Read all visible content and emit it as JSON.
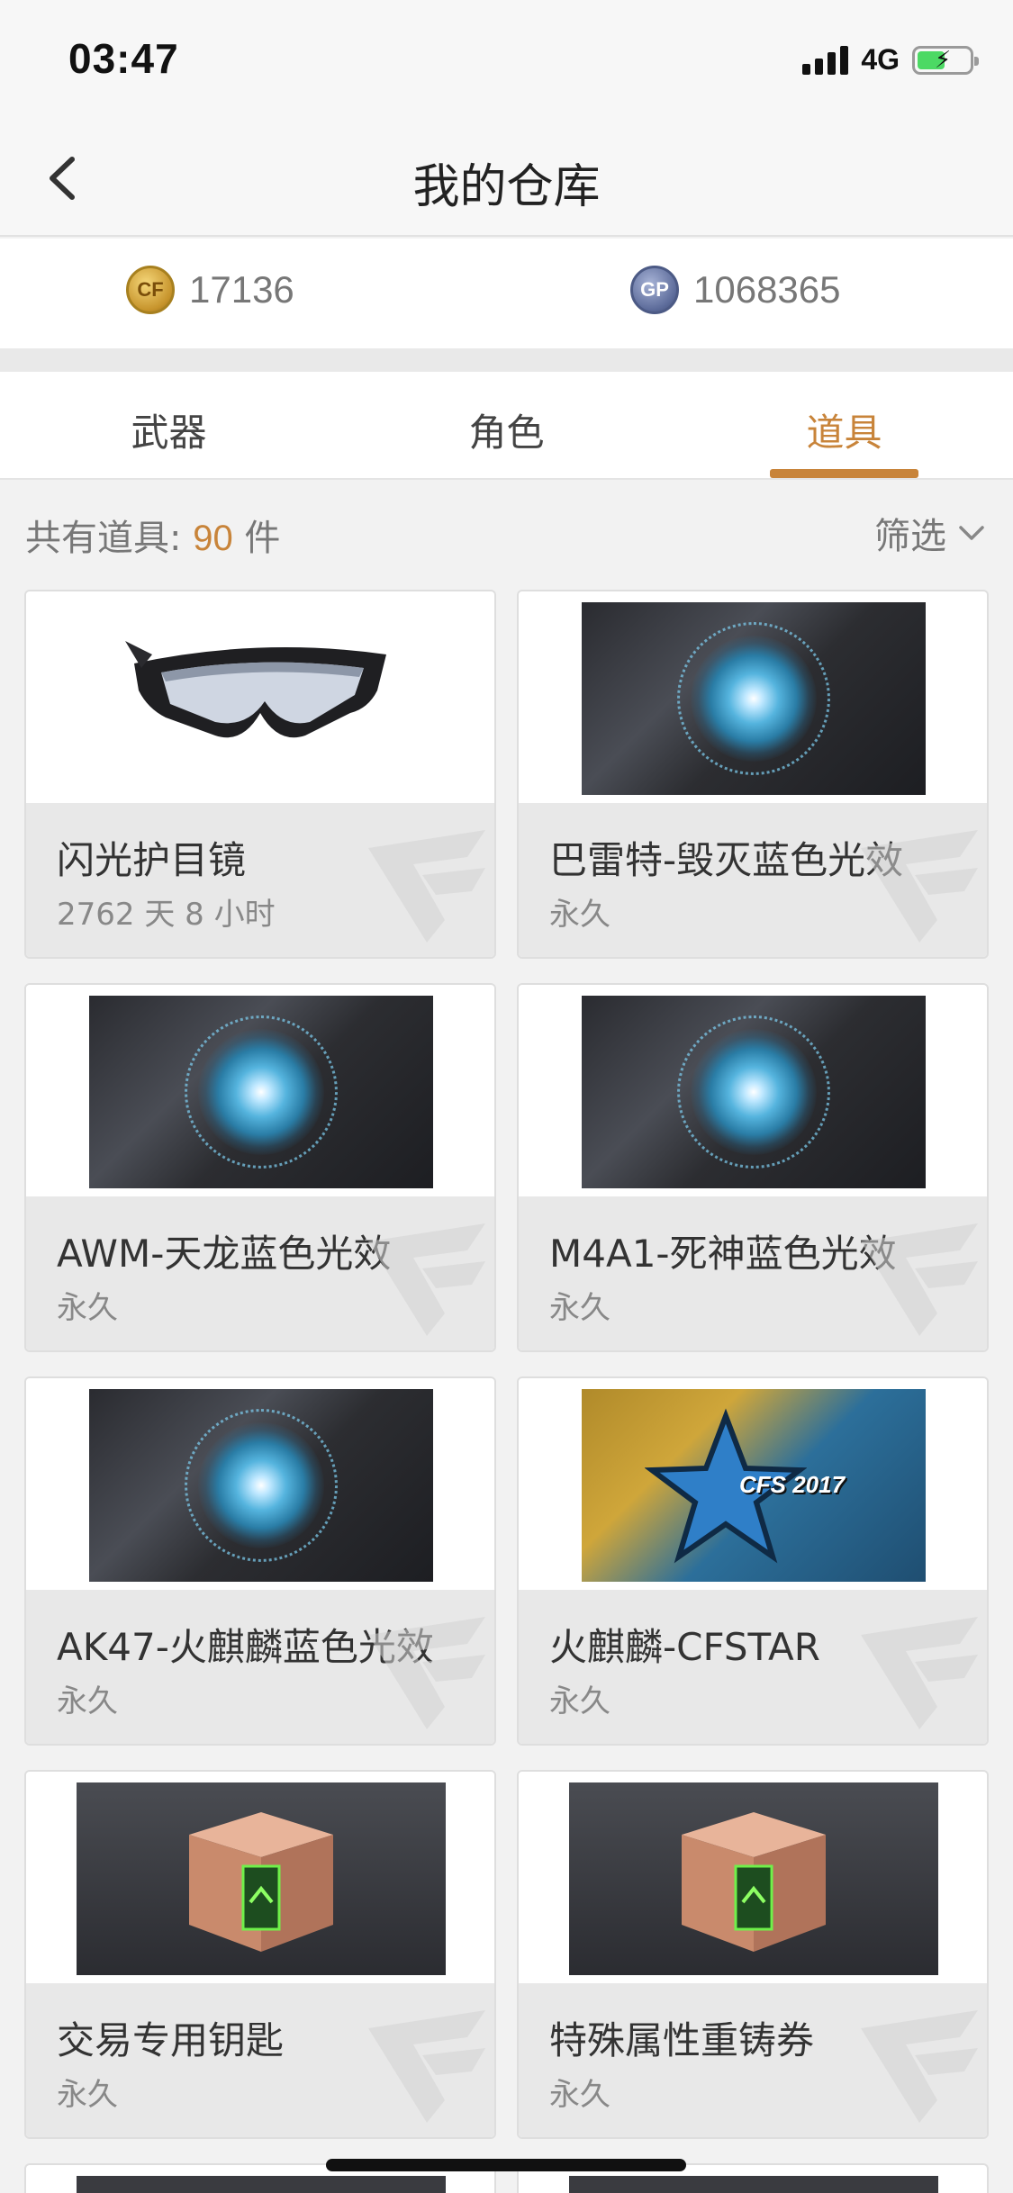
{
  "status_bar": {
    "time": "03:47",
    "network": "4G"
  },
  "nav": {
    "title": "我的仓库"
  },
  "currency": {
    "coins": "17136",
    "coin_icon_label": "CF",
    "gp": "1068365",
    "gp_icon_label": "GP"
  },
  "tabs": [
    {
      "label": "武器",
      "active": false
    },
    {
      "label": "角色",
      "active": false
    },
    {
      "label": "道具",
      "active": true
    }
  ],
  "summary": {
    "prefix": "共有道具:",
    "count": "90",
    "unit": "件",
    "filter_label": "筛选"
  },
  "items": [
    {
      "name": "闪光护目镜",
      "duration": "2762 天 8 小时",
      "image": "goggles"
    },
    {
      "name": "巴雷特-毁灭蓝色光效",
      "duration": "永久",
      "image": "blue-glow"
    },
    {
      "name": "AWM-天龙蓝色光效",
      "duration": "永久",
      "image": "blue-glow"
    },
    {
      "name": "M4A1-死神蓝色光效",
      "duration": "永久",
      "image": "blue-glow"
    },
    {
      "name": "AK47-火麒麟蓝色光效",
      "duration": "永久",
      "image": "blue-glow"
    },
    {
      "name": "火麒麟-CFSTAR",
      "duration": "永久",
      "image": "cfs-star",
      "image_text": "CFS 2017"
    },
    {
      "name": "交易专用钥匙",
      "duration": "永久",
      "image": "crate"
    },
    {
      "name": "特殊属性重铸券",
      "duration": "永久",
      "image": "crate"
    }
  ],
  "colors": {
    "accent": "#c8843a",
    "tab_text": "#444444",
    "footer_bg": "#e8e8e8"
  }
}
